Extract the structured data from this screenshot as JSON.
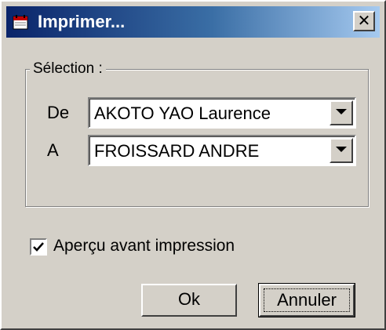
{
  "window": {
    "title": "Imprimer..."
  },
  "icons": {
    "app": "printer-calendar-icon",
    "close": "close-icon",
    "dropdown": "chevron-down-icon",
    "check": "checkmark-icon"
  },
  "colors": {
    "titlebar_start": "#0a246a",
    "titlebar_end": "#a6caf0",
    "face": "#d4d0c8"
  },
  "selection": {
    "legend": "Sélection :",
    "from_label": "De",
    "from_value": "AKOTO YAO Laurence",
    "to_label": "A",
    "to_value": "FROISSARD ANDRE"
  },
  "preview": {
    "label": "Aperçu avant impression",
    "checked": true
  },
  "buttons": {
    "ok": "Ok",
    "cancel": "Annuler"
  }
}
